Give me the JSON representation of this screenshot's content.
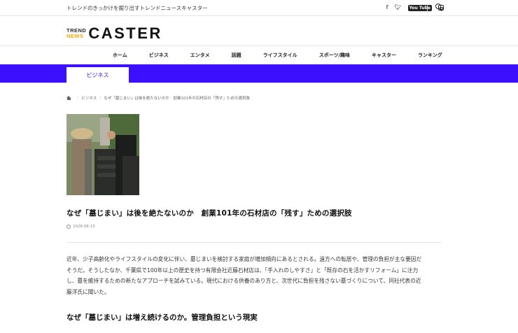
{
  "topbar": {
    "tagline": "トレンドのきっかけを掘り出すトレンドニュースキャスター",
    "social": [
      "facebook-icon",
      "twitter-icon",
      "youtube-icon",
      "instagram-icon"
    ],
    "youtube_label": "You Tube"
  },
  "logo": {
    "line1": "TREND",
    "line2": "NEWS",
    "main": "CASTER"
  },
  "nav": [
    "ホーム",
    "ビジネス",
    "エンタメ",
    "話題",
    "ライフスタイル",
    "スポーツ/趣味",
    "キャスター",
    "ランキング"
  ],
  "category": {
    "active": "ビジネス",
    "bar_color": "#3d0fff"
  },
  "breadcrumb": {
    "category": "ビジネス",
    "current": "なぜ「墓じまい」は後を絶たないのか　創業101年の石材店の「残す」ための選択肢"
  },
  "article": {
    "title": "なぜ「墓じまい」は後を絶たないのか　創業101年の石材店の「残す」ための選択肢",
    "date": "2026.08.13",
    "lead": [
      "近年、少子高齢化やライフスタイルの変化に伴い、墓じまいを検討する家庭が増加傾向にあるとされる。遠方への転居や、管理の負担が主な要因だ",
      "そうだ。そうしたなか、千葉県で100年以上の歴史を持つ有限会社近藤石材店は、「手入れのしやすさ」と「既存の石を活かすリフォーム」に注力",
      "し、墓を維持するための新たなアプローチを試みている。現代における供養のあり方と、次世代に負担を残さない墓づくりについて、同社代表の近",
      "藤洋氏に聞いた。"
    ],
    "heading": "なぜ「墓じまい」は増え続けるのか。管理負担という現実"
  }
}
